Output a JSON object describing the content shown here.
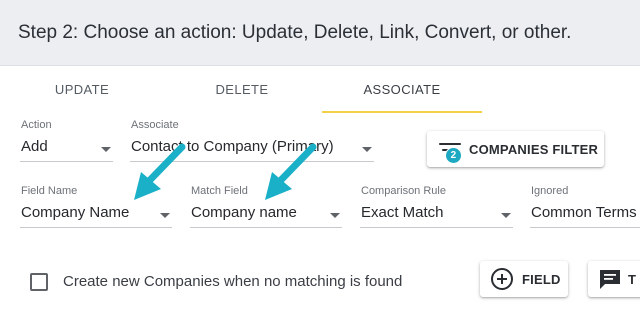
{
  "header": {
    "title": "Step 2: Choose an action: Update, Delete, Link, Convert, or other."
  },
  "tabs": [
    {
      "label": "UPDATE"
    },
    {
      "label": "DELETE"
    },
    {
      "label": "ASSOCIATE",
      "active": true
    }
  ],
  "row1": {
    "action": {
      "label": "Action",
      "value": "Add"
    },
    "associate": {
      "label": "Associate",
      "value": "Contact to Company (Primary)"
    },
    "filter_button": {
      "label": "COMPANIES FILTER",
      "badge": "2",
      "icon": "filter-icon"
    }
  },
  "row2": {
    "field_name": {
      "label": "Field Name",
      "value": "Company Name"
    },
    "match_field": {
      "label": "Match Field",
      "value": "Company name"
    },
    "comparison_rule": {
      "label": "Comparison Rule",
      "value": "Exact Match"
    },
    "ignored": {
      "label": "Ignored",
      "value": "Common Terms"
    }
  },
  "bottom": {
    "checkbox_label": "Create new Companies when no matching is found",
    "checkbox_checked": false,
    "field_button": {
      "label": "FIELD",
      "icon": "add-circle-icon"
    },
    "text_button": {
      "label": "T",
      "icon": "text-icon"
    }
  },
  "colors": {
    "accent_underline": "#f3d24a",
    "badge": "#1da9c2",
    "annotation_arrow": "#1ab0c8"
  }
}
